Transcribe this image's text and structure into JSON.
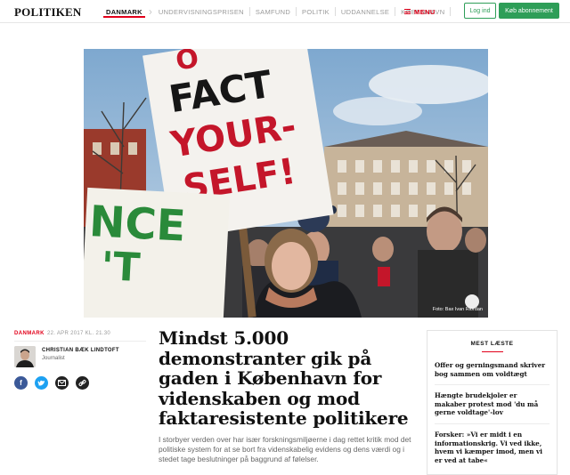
{
  "header": {
    "logo": "POLITIKEN",
    "nav": [
      {
        "label": "DANMARK",
        "active": true
      },
      {
        "label": "UNDERVISNINGSPRISEN"
      },
      {
        "label": "SAMFUND"
      },
      {
        "label": "POLITIK"
      },
      {
        "label": "UDDANNELSE"
      },
      {
        "label": "KØBENHAVN"
      }
    ],
    "menu_label": "MENU",
    "login_label": "Log ind",
    "subscribe_label": "Køb abonnement"
  },
  "hero": {
    "sign_main": [
      "FACT",
      "YOUR-",
      "SELF!"
    ],
    "sign_top": "O",
    "sign_green": [
      "NCE",
      "'T"
    ],
    "credit": "Foto: Bax Ivan Riordan"
  },
  "article": {
    "section": "DANMARK",
    "datetime": "22. APR 2017 KL. 21.30",
    "author_name": "CHRISTIAN BÆK LINDTOFT",
    "author_role": "Journalist",
    "headline": "Mindst 5.000 demonstranter gik på gaden i København for videnskaben og mod faktaresistente politikere",
    "lead": "I storbyer verden over har især forskningsmiljøerne i dag rettet kritik mod det politiske system for at se bort fra videnskabelig evidens og dens værdi og i stedet tage beslutninger på baggrund af følelser."
  },
  "most_read": {
    "title": "MEST LÆSTE",
    "items": [
      "Offer og gerningsmand skriver bog sammen om voldtægt",
      "Hængte brudekjoler er makaber protest mod 'du må gerne voldtage'-lov",
      "Forsker: »Vi er midt i en informationskrig. Vi ved ikke, hvem vi kæmper imod, men vi er ved at tabe«"
    ]
  },
  "colors": {
    "accent_red": "#e2001a",
    "brand_green": "#2e9e58",
    "facebook": "#3b5998",
    "twitter": "#1da1f2"
  },
  "icons": [
    "facebook-icon",
    "twitter-icon",
    "mail-icon",
    "link-icon",
    "menu-icon",
    "chevron-right-icon"
  ]
}
